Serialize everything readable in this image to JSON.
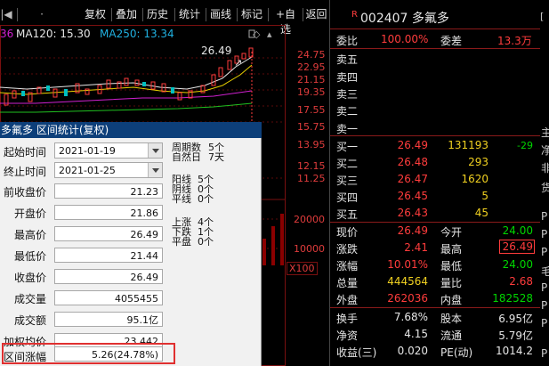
{
  "toolbar": {
    "buttons": [
      "复权",
      "叠加",
      "历史",
      "统计",
      "画线",
      "标记",
      "+自选",
      "返回"
    ]
  },
  "chart": {
    "ma_partial": "36",
    "ma120": "MA120: 15.30",
    "ma250": "MA250: 13.34",
    "peak_label": "26.49",
    "price_ticks": [
      "24.75",
      "22.95",
      "21.15",
      "19.35",
      "17.55",
      "15.75",
      "13.95",
      "12.15",
      "11.25"
    ],
    "volume_ticks": [
      "20000",
      "10000"
    ],
    "volume_unit": "X100"
  },
  "dialog": {
    "title": "多氟多 区间统计(复权)",
    "start_label": "起始时间",
    "start_value": "2021-01-19",
    "end_label": "终止时间",
    "end_value": "2021-01-25",
    "rows": [
      {
        "label": "前收盘价",
        "value": "21.23"
      },
      {
        "label": "开盘价",
        "value": "21.86"
      },
      {
        "label": "最高价",
        "value": "26.49"
      },
      {
        "label": "最低价",
        "value": "21.44"
      },
      {
        "label": "收盘价",
        "value": "26.49"
      },
      {
        "label": "成交量",
        "value": "4055455"
      },
      {
        "label": "成交额",
        "value": "95.1亿"
      },
      {
        "label": "加权均价",
        "value": "23.442"
      },
      {
        "label": "区间涨幅",
        "value": "5.26(24.78%)"
      }
    ],
    "side": {
      "period": "周期数",
      "period_val": "5个",
      "natural": "自然日",
      "natural_val": "7天",
      "yang": "阳线",
      "yang_val": "5个",
      "yin": "阴线",
      "yin_val": "0个",
      "flat": "平线",
      "flat_val": "0个",
      "up": "上涨",
      "up_val": "4个",
      "down": "下跌",
      "down_val": "1个",
      "level": "平盘",
      "level_val": "0个"
    }
  },
  "quote": {
    "badge": "R",
    "code_name": "002407 多氟多",
    "webi_label": "委比",
    "webi_value": "100.00%",
    "weicha_label": "委差",
    "weicha_value": "13.3万",
    "asks": [
      "卖五",
      "卖四",
      "卖三",
      "卖二",
      "卖一"
    ],
    "bids": [
      {
        "label": "买一",
        "price": "26.49",
        "vol": "131193",
        "chg": "-29"
      },
      {
        "label": "买二",
        "price": "26.48",
        "vol": "293",
        "chg": ""
      },
      {
        "label": "买三",
        "price": "26.47",
        "vol": "1620",
        "chg": ""
      },
      {
        "label": "买四",
        "price": "26.45",
        "vol": "5",
        "chg": ""
      },
      {
        "label": "买五",
        "price": "26.43",
        "vol": "45",
        "chg": ""
      }
    ],
    "stats": [
      {
        "l1": "现价",
        "v1": "26.49",
        "l2": "今开",
        "v2": "24.00"
      },
      {
        "l1": "涨跌",
        "v1": "2.41",
        "l2": "最高",
        "v2": "26.49"
      },
      {
        "l1": "涨幅",
        "v1": "10.01%",
        "l2": "最低",
        "v2": "24.00"
      },
      {
        "l1": "总量",
        "v1": "444564",
        "l2": "量比",
        "v2": "2.68"
      },
      {
        "l1": "外盘",
        "v1": "262036",
        "l2": "内盘",
        "v2": "182528"
      }
    ],
    "fund": [
      {
        "l1": "换手",
        "v1": "7.68%",
        "l2": "股本",
        "v2": "6.95亿"
      },
      {
        "l1": "净资",
        "v1": "4.15",
        "l2": "流通",
        "v2": "5.79亿"
      },
      {
        "l1": "收益(三)",
        "v1": "0.020",
        "l2": "PE(动)",
        "v2": "1014.2"
      }
    ]
  },
  "edge": [
    "主",
    "净",
    "非",
    "货",
    "P",
    "P",
    "P",
    "毛",
    "P",
    "P",
    "P",
    "P"
  ],
  "colors": {
    "highlight_box": "#e03030",
    "title_bar": "#0d3f7a"
  }
}
